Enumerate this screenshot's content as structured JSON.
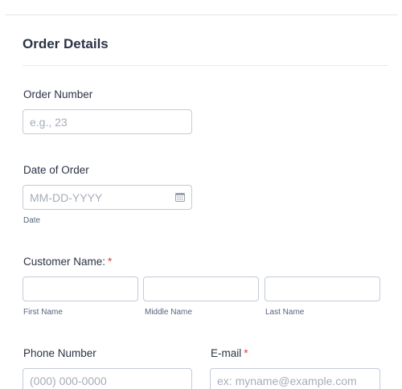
{
  "section": {
    "title": "Order Details"
  },
  "order_number": {
    "label": "Order Number",
    "placeholder": "e.g., 23"
  },
  "order_date": {
    "label": "Date of Order",
    "placeholder": "MM-DD-YYYY",
    "sublabel": "Date",
    "icon": "calendar-icon"
  },
  "customer_name": {
    "label": "Customer Name:",
    "required_mark": "*",
    "first_sublabel": "First Name",
    "middle_sublabel": "Middle Name",
    "last_sublabel": "Last Name"
  },
  "phone": {
    "label": "Phone Number",
    "placeholder": "(000) 000-0000"
  },
  "email": {
    "label": "E-mail",
    "required_mark": "*",
    "placeholder": "ex: myname@example.com"
  },
  "colors": {
    "required": "#e03c3c",
    "border": "#c3cad8",
    "text": "#2c3345"
  }
}
